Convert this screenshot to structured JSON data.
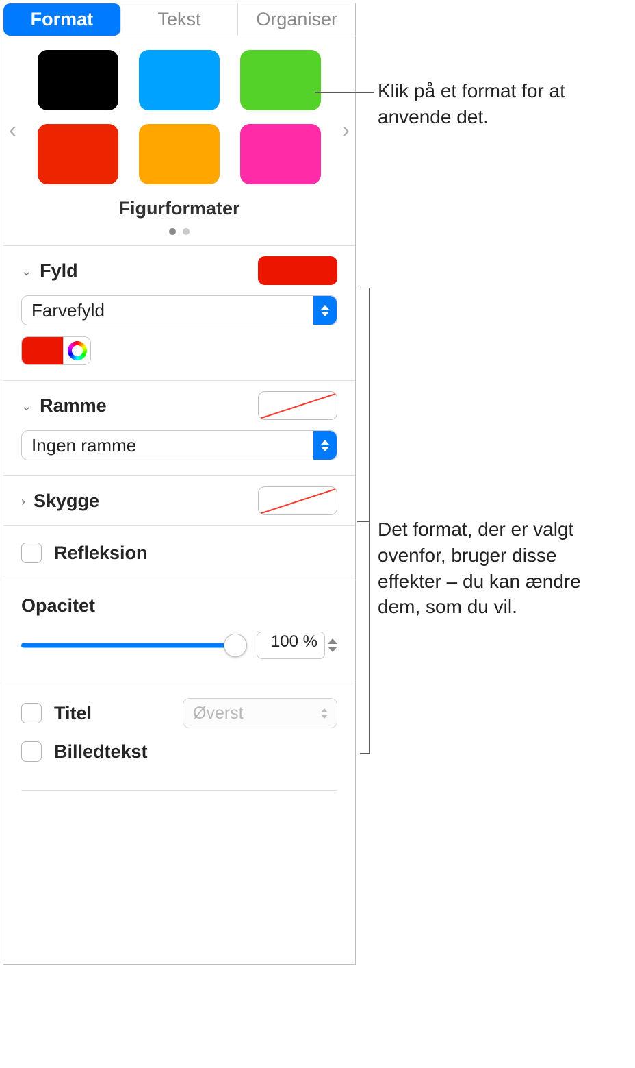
{
  "tabs": {
    "format": "Format",
    "text": "Tekst",
    "organize": "Organiser"
  },
  "styles": {
    "label": "Figurformater",
    "swatches": [
      "#000000",
      "#00a2ff",
      "#54d22a",
      "#ed2400",
      "#ffa700",
      "#ff2ba7"
    ]
  },
  "sections": {
    "fill": {
      "title": "Fyld",
      "type": "Farvefyld",
      "color": "#eb1500"
    },
    "border": {
      "title": "Ramme",
      "type": "Ingen ramme"
    },
    "shadow": {
      "title": "Skygge"
    },
    "reflection": {
      "title": "Refleksion"
    },
    "opacity": {
      "title": "Opacitet",
      "value": "100 %"
    },
    "title_cb": {
      "title": "Titel",
      "position": "Øverst"
    },
    "caption_cb": {
      "title": "Billedtekst"
    }
  },
  "callouts": {
    "top": "Klik på et format for at anvende det.",
    "middle": "Det format, der er valgt ovenfor, bruger disse effekter – du kan ændre dem, som du vil."
  }
}
